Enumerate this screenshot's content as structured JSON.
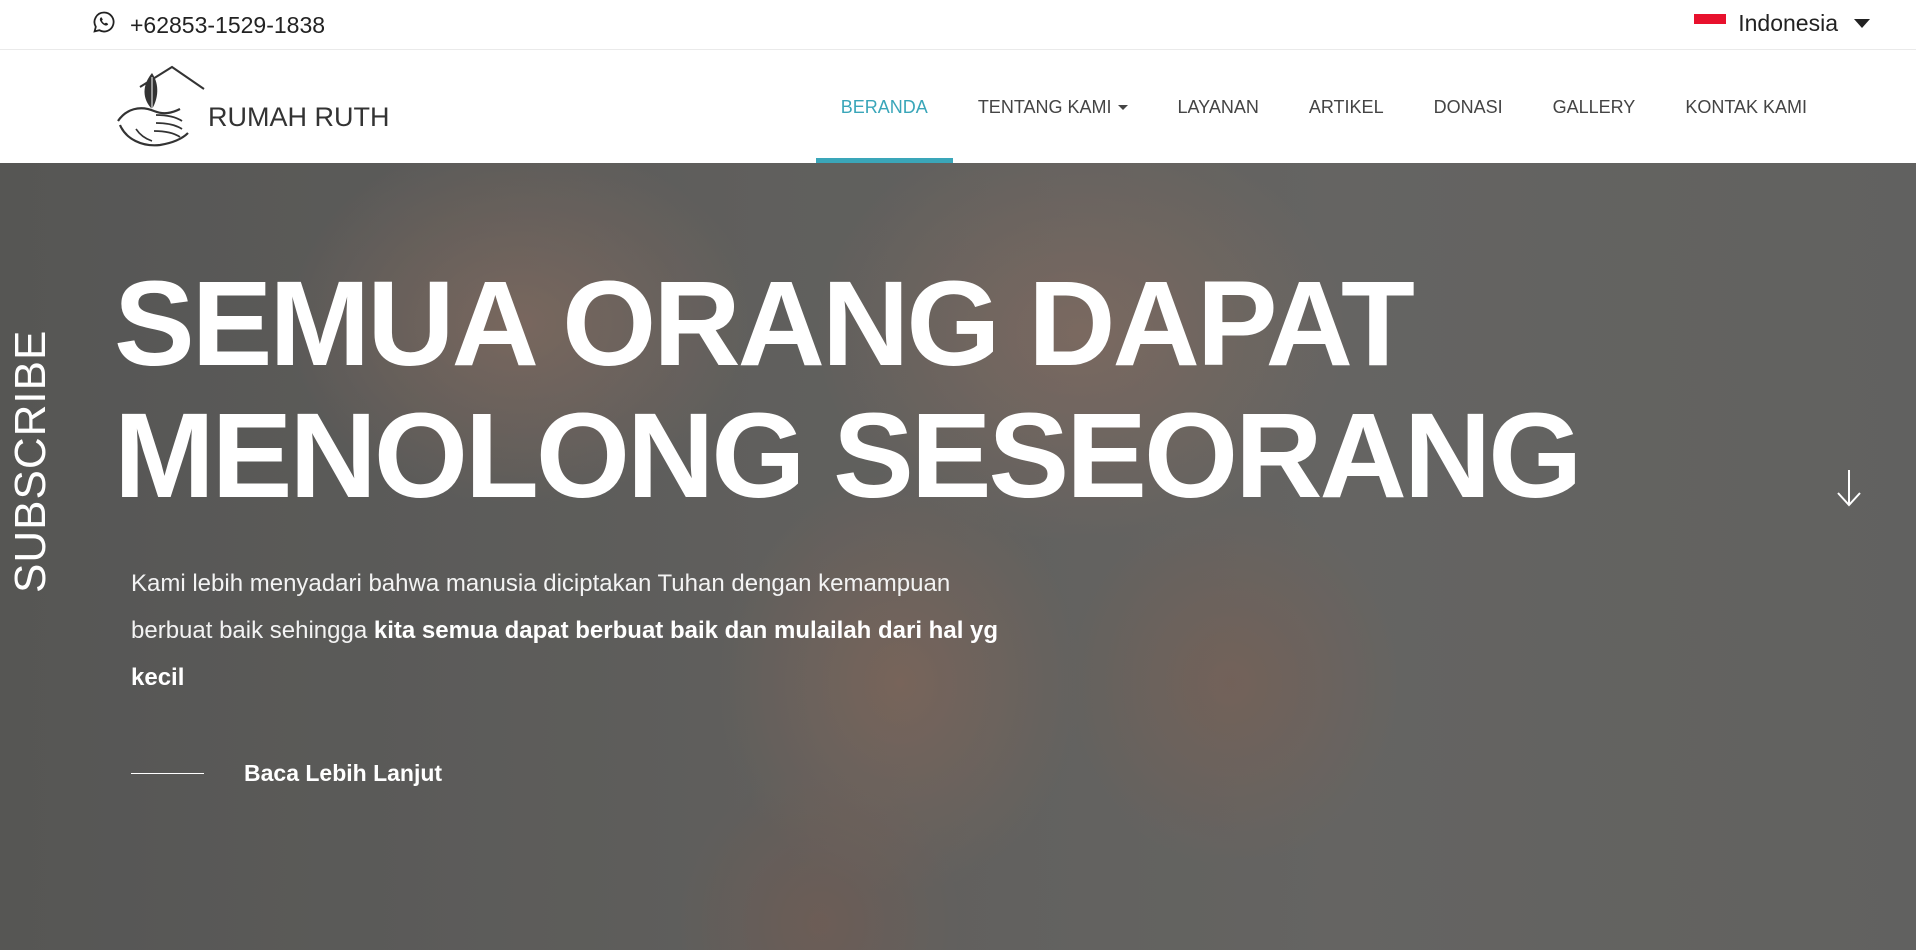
{
  "topbar": {
    "phone_icon": "whatsapp-icon",
    "phone": "+62853-1529-1838",
    "language": "Indonesia",
    "flag_colors": [
      "#e8112d",
      "#ffffff"
    ]
  },
  "header": {
    "logo_text": "RUMAH RUTH",
    "nav": [
      {
        "label": "BERANDA",
        "active": true
      },
      {
        "label": "TENTANG KAMI",
        "dropdown": true
      },
      {
        "label": "LAYANAN"
      },
      {
        "label": "ARTIKEL"
      },
      {
        "label": "DONASI"
      },
      {
        "label": "GALLERY"
      },
      {
        "label": "KONTAK KAMI"
      }
    ],
    "accent_color": "#3aa6b9"
  },
  "hero": {
    "side_label": "SUBSCRIBE",
    "headline_line1": "SEMUA ORANG DAPAT",
    "headline_line2": "MENOLONG SESEORANG",
    "lead_plain": "Kami lebih menyadari bahwa manusia diciptakan Tuhan dengan kemampuan berbuat baik sehingga",
    "lead_bold": "kita semua dapat berbuat baik dan mulailah dari hal yg kecil",
    "cta": "Baca Lebih Lanjut",
    "scroll_icon": "arrow-down-icon"
  }
}
